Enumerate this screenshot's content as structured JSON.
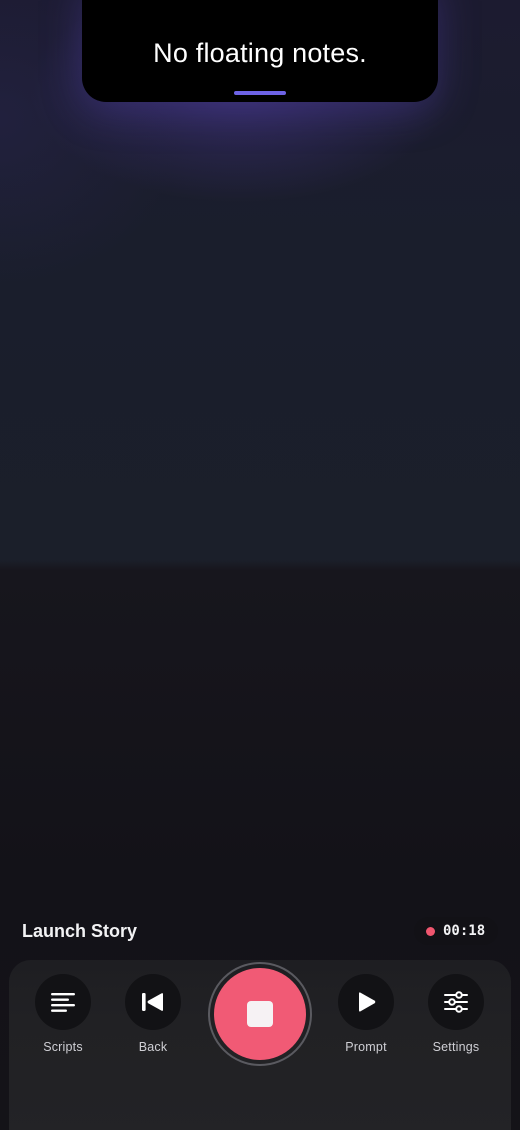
{
  "prompter": {
    "text": "No floating notes."
  },
  "story": {
    "title": "Launch Story"
  },
  "recording": {
    "elapsed": "00:18",
    "status_color": "#f0566f"
  },
  "controls": {
    "scripts": {
      "label": "Scripts",
      "icon": "list-lines-icon"
    },
    "back": {
      "label": "Back",
      "icon": "skip-back-icon"
    },
    "record": {
      "icon": "stop-icon",
      "color": "#f15a75"
    },
    "prompt": {
      "label": "Prompt",
      "icon": "play-icon"
    },
    "settings": {
      "label": "Settings",
      "icon": "sliders-icon"
    }
  },
  "colors": {
    "accent_underline": "#6e63e6",
    "background": "#141318"
  }
}
